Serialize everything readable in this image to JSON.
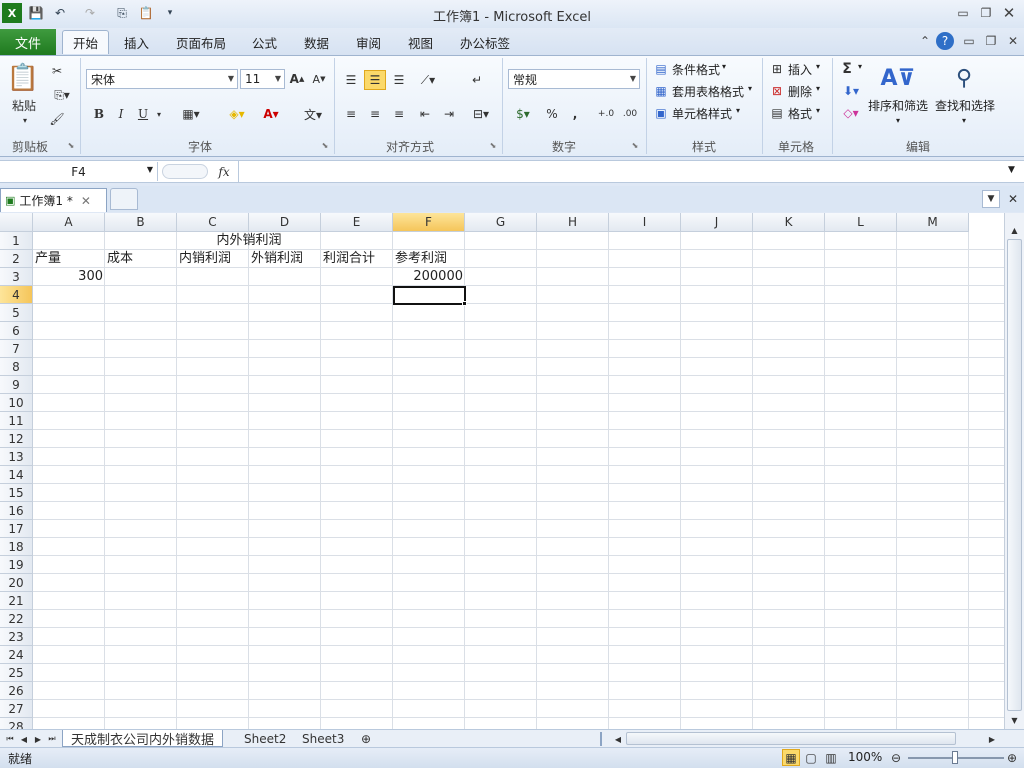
{
  "window": {
    "title": "工作簿1  -  Microsoft Excel"
  },
  "ribbon": {
    "file_tab": "文件",
    "tabs": [
      "开始",
      "插入",
      "页面布局",
      "公式",
      "数据",
      "审阅",
      "视图",
      "办公标签"
    ],
    "clipboard": {
      "paste": "粘贴",
      "label": "剪贴板"
    },
    "font": {
      "name": "宋体",
      "size": "11",
      "bold": "B",
      "italic": "I",
      "underline": "U",
      "label": "字体"
    },
    "alignment": {
      "label": "对齐方式"
    },
    "number": {
      "format": "常规",
      "percent": "%",
      "comma": ",",
      "label": "数字"
    },
    "styles": {
      "conditional": "条件格式",
      "table": "套用表格格式",
      "cell": "单元格样式",
      "label": "样式"
    },
    "cells": {
      "insert": "插入",
      "delete": "删除",
      "format": "格式",
      "label": "单元格"
    },
    "editing": {
      "sum": "Σ",
      "sort": "排序和筛选",
      "find": "查找和选择",
      "label": "编辑"
    }
  },
  "formula_bar": {
    "name_box": "F4",
    "fx": "fx",
    "value": ""
  },
  "document": {
    "tab": "工作簿1 *"
  },
  "sheet": {
    "columns": [
      "A",
      "B",
      "C",
      "D",
      "E",
      "F",
      "G",
      "H",
      "I",
      "J",
      "K",
      "L",
      "M"
    ],
    "rows": [
      "1",
      "2",
      "3",
      "4",
      "5",
      "6",
      "7",
      "8",
      "9",
      "10",
      "11",
      "12",
      "13",
      "14",
      "15",
      "16",
      "17",
      "18",
      "19",
      "20",
      "21",
      "22",
      "23",
      "24",
      "25",
      "26",
      "27",
      "28"
    ],
    "cells": {
      "C1": "内外销利润",
      "A2": "产量",
      "B2": "成本",
      "C2": "内销利润",
      "D2": "外销利润",
      "E2": "利润合计",
      "F2": "参考利润",
      "A3": "300",
      "F3": "200000"
    },
    "selected": "F4"
  },
  "sheet_tabs": [
    "天成制衣公司内外销数据",
    "Sheet2",
    "Sheet3"
  ],
  "status": {
    "ready": "就绪",
    "zoom": "100%"
  }
}
